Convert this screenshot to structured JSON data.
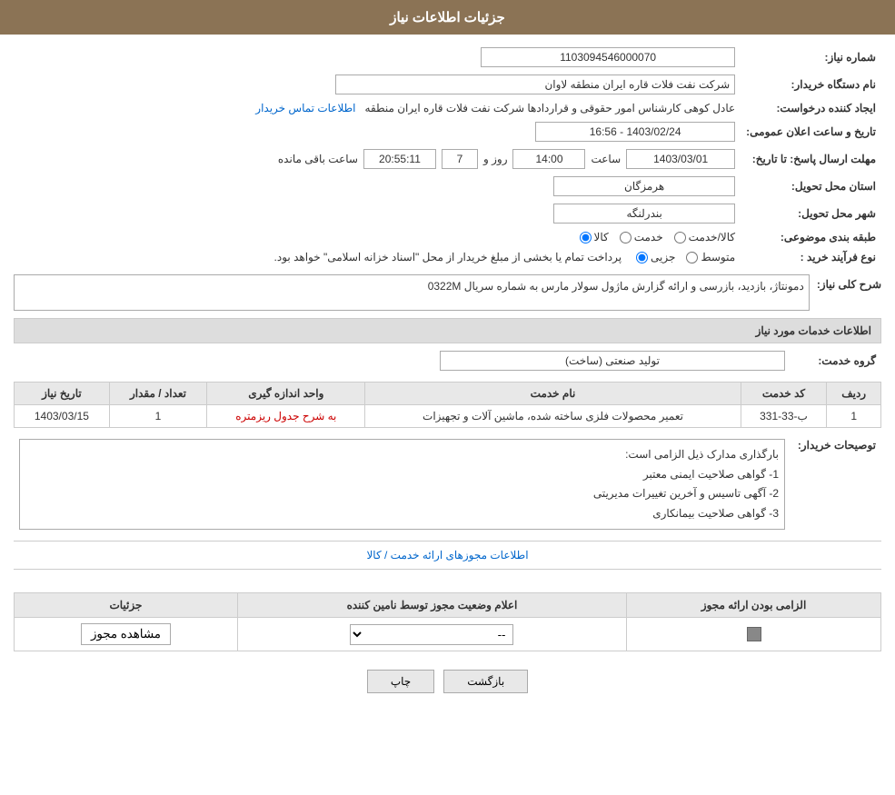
{
  "header": {
    "title": "جزئیات اطلاعات نیاز"
  },
  "fields": {
    "need_number_label": "شماره نیاز:",
    "need_number_value": "1103094546000070",
    "buyer_org_label": "نام دستگاه خریدار:",
    "buyer_org_value": "شرکت نفت فلات قاره ایران منطقه لاوان",
    "creator_label": "ایجاد کننده درخواست:",
    "creator_value": "عادل کوهی کارشناس امور حقوقی و قراردادها شرکت نفت فلات قاره ایران منطقه",
    "creator_link": "اطلاعات تماس خریدار",
    "announce_date_label": "تاریخ و ساعت اعلان عمومی:",
    "announce_date_value": "1403/02/24 - 16:56",
    "response_deadline_label": "مهلت ارسال پاسخ: تا تاریخ:",
    "response_date_value": "1403/03/01",
    "response_time_label": "ساعت",
    "response_time_value": "14:00",
    "response_days_label": "روز و",
    "response_days_value": "7",
    "response_remaining_label": "ساعت باقی مانده",
    "response_remaining_value": "20:55:11",
    "delivery_province_label": "استان محل تحویل:",
    "delivery_province_value": "هرمزگان",
    "delivery_city_label": "شهر محل تحویل:",
    "delivery_city_value": "بندرلنگه",
    "category_label": "طبقه بندی موضوعی:",
    "category_options": [
      "کالا",
      "خدمت",
      "کالا/خدمت"
    ],
    "category_selected": "کالا",
    "purchase_type_label": "نوع فرآیند خرید :",
    "purchase_options": [
      "جزیی",
      "متوسط"
    ],
    "purchase_note": "پرداخت تمام یا بخشی از مبلغ خریدار از محل \"اسناد خزانه اسلامی\" خواهد بود.",
    "need_description_label": "شرح کلی نیاز:",
    "need_description_value": "دمونتاژ، بازدید، بازرسی و ارائه گزارش ماژول سولار مارس به شماره سریال 0322M",
    "service_info_label": "اطلاعات خدمات مورد نیاز",
    "service_group_label": "گروه خدمت:",
    "service_group_value": "تولید صنعتی (ساخت)",
    "table": {
      "headers": [
        "ردیف",
        "کد خدمت",
        "نام خدمت",
        "واحد اندازه گیری",
        "تعداد / مقدار",
        "تاریخ نیاز"
      ],
      "rows": [
        {
          "row": "1",
          "service_code": "ب-33-331",
          "service_name": "تعمیر محصولات فلزی ساخته شده، ماشین آلات و تجهیزات",
          "unit": "به شرح جدول ریزمتره",
          "quantity": "1",
          "date": "1403/03/15"
        }
      ]
    },
    "buyer_notes_label": "توصیحات خریدار:",
    "buyer_notes_lines": [
      "بارگذاری مدارک ذیل الزامی است:",
      "1-   گواهی صلاحیت ایمنی معتبر",
      "2-   آگهی تاسیس و آخرین تغییرات مدیریتی",
      "3-   گواهی صلاحیت بیمانکاری"
    ],
    "permit_section_link": "اطلاعات مجوزهای ارائه خدمت / کالا",
    "permit_table": {
      "headers": [
        "الزامی بودن ارائه مجوز",
        "اعلام وضعیت مجوز توسط نامین کننده",
        "جزئیات"
      ],
      "rows": [
        {
          "required": "checked",
          "status": "--",
          "details": "مشاهده مجوز"
        }
      ]
    },
    "status_dropdown_options": [
      "--"
    ],
    "status_dropdown_value": "--"
  },
  "buttons": {
    "print_label": "چاپ",
    "back_label": "بازگشت"
  }
}
